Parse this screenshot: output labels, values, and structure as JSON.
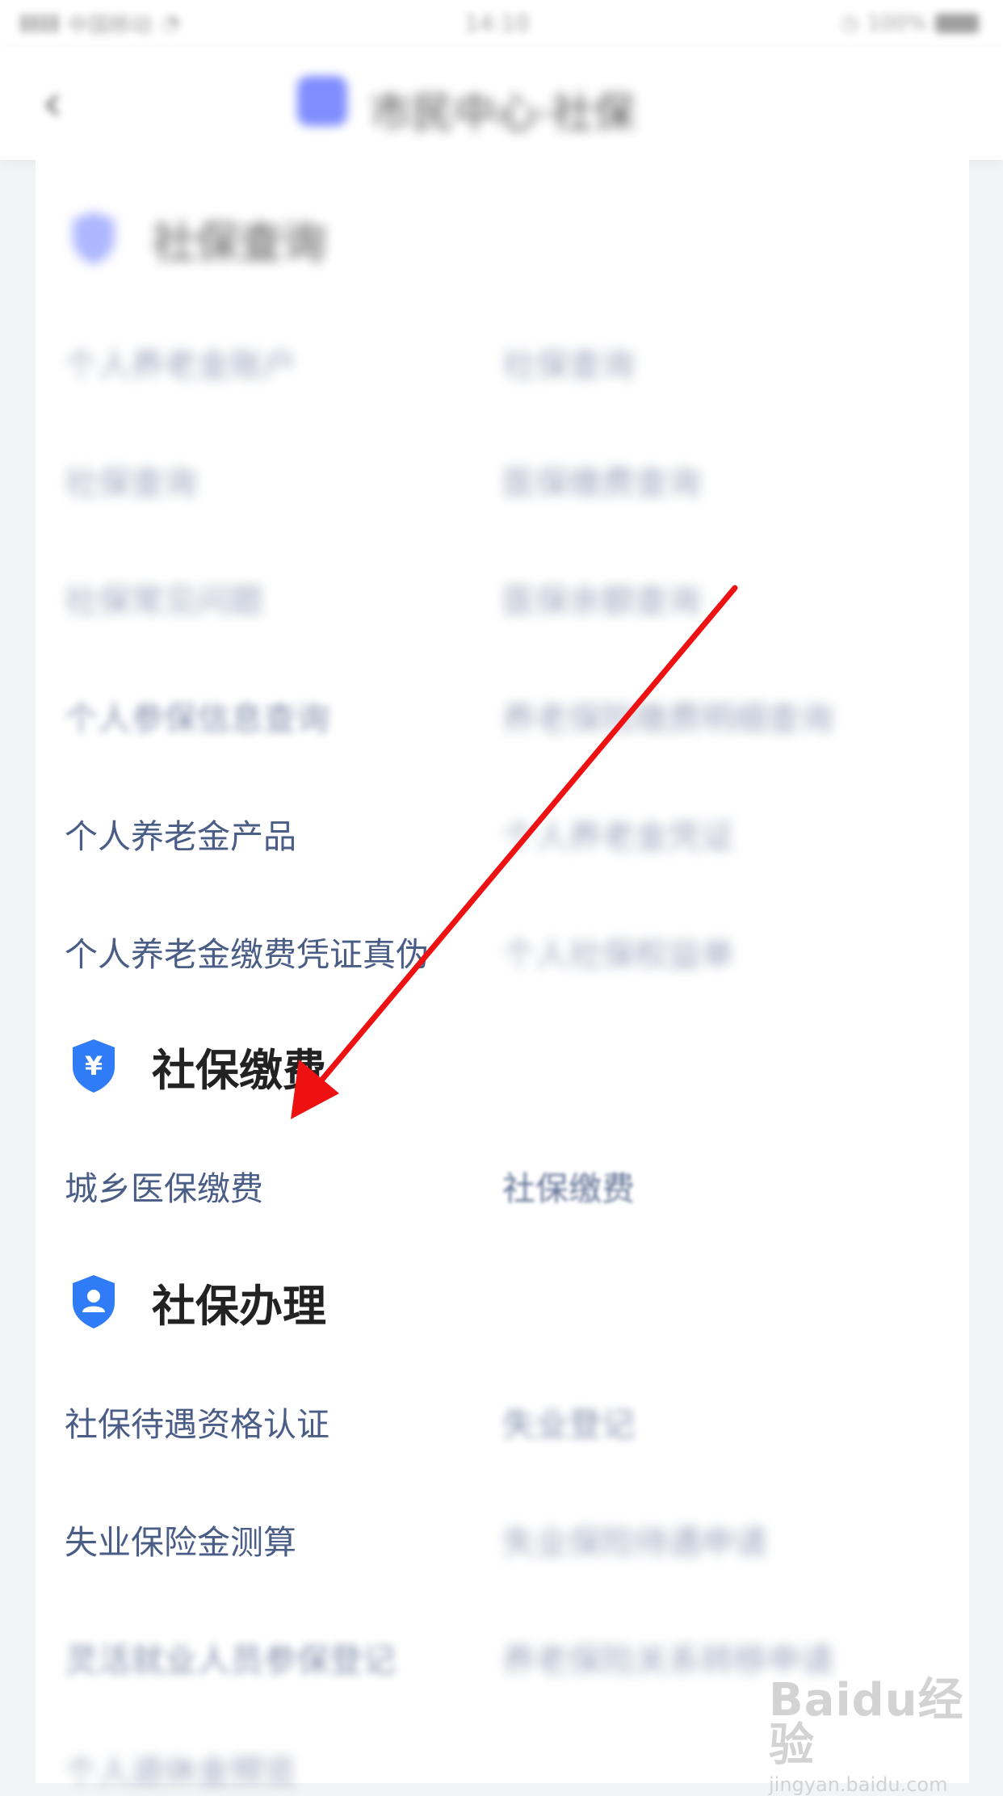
{
  "status_bar": {
    "carrier": "中国移动",
    "time": "14:10",
    "battery": "100%"
  },
  "header": {
    "title": "市民中心·社保"
  },
  "sections": {
    "query": {
      "title": "社保查询",
      "items": [
        "个人养老金账户",
        "社保查询",
        "社保查询",
        "医保缴费查询",
        "社保常见问题",
        "医保余额查询",
        "个人参保信息查询",
        "养老保险缴费明细查询",
        "个人养老金产品",
        "个人养老金凭证",
        "个人养老金缴费凭证真伪",
        "个人社保权益单"
      ]
    },
    "payment": {
      "title": "社保缴费",
      "items": [
        "城乡医保缴费",
        "社保缴费"
      ]
    },
    "handling": {
      "title": "社保办理",
      "items": [
        "社保待遇资格认证",
        "失业登记",
        "失业保险金测算",
        "失业保险待遇申请",
        "灵活就业人员参保登记",
        "养老保险关系转移申请",
        "个人退休金预览"
      ]
    }
  },
  "watermark": {
    "main": "Baidu经验",
    "sub": "jingyan.baidu.com"
  },
  "colors": {
    "accent_blue": "#2f7cf6",
    "item_text": "#4a5d86",
    "arrow_red": "#ee1111"
  }
}
